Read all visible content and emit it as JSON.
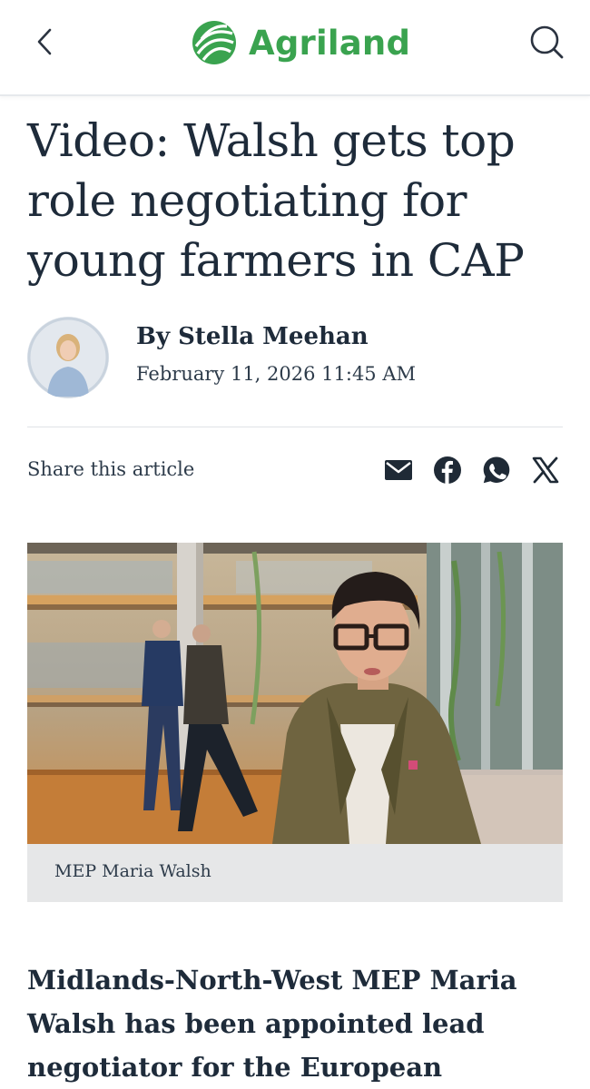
{
  "app": {
    "logo_text": "Agriland",
    "brand_color": "#3aa34f"
  },
  "nav": {
    "back_icon": "chevron-left-icon",
    "search_icon": "search-icon"
  },
  "article": {
    "headline": "Video: Walsh gets top role negotiating for young farmers in CAP",
    "author": "By Stella Meehan",
    "date": "February 11, 2026 11:45 AM",
    "share_label": "Share this article",
    "share_icons": [
      "email-icon",
      "facebook-icon",
      "whatsapp-icon",
      "x-icon"
    ],
    "image_caption": "MEP Maria Walsh",
    "lead": "Midlands-North-West MEP Maria Walsh has been appointed lead negotiator for the European"
  }
}
